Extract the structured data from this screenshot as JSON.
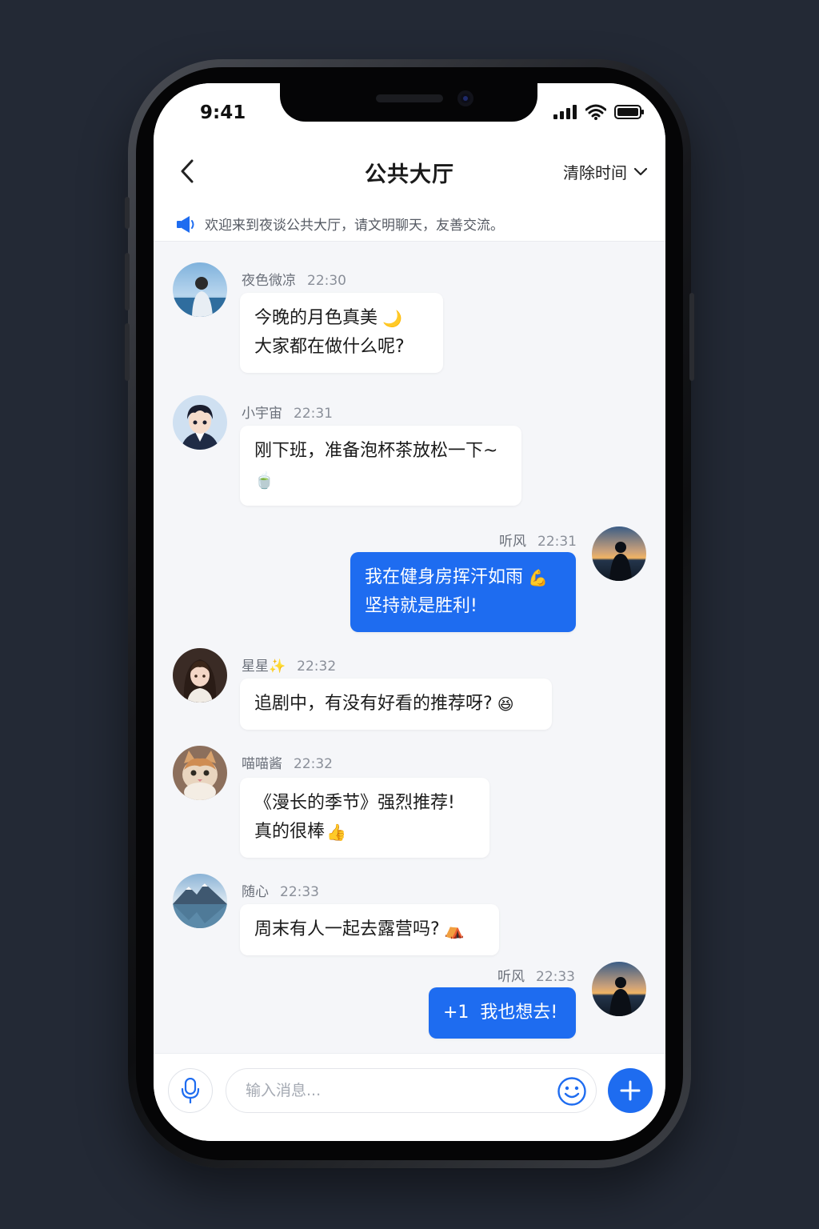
{
  "status_bar": {
    "time": "9:41"
  },
  "header": {
    "title": "公共大厅",
    "clear_label": "清除时间"
  },
  "notice": {
    "text": "欢迎来到夜谈公共大厅，请文明聊天，友善交流。"
  },
  "messages": [
    {
      "user": "夜色微凉",
      "time": "22:30",
      "lines": [
        "今晚的月色真美",
        "大家都在做什么呢?"
      ],
      "emoji": "🌙",
      "self": false,
      "avatar": "man-by-sea"
    },
    {
      "user": "小宇宙",
      "time": "22:31",
      "lines": [
        "刚下班，准备泡杯茶放松一下~",
        ""
      ],
      "emoji": "🍵",
      "self": false,
      "avatar": "anime-boy"
    },
    {
      "user": "听风",
      "time": "22:31",
      "lines": [
        "我在健身房挥汗如雨",
        "坚持就是胜利!"
      ],
      "emoji": "💪",
      "self": true,
      "avatar": "sunset-silhouette"
    },
    {
      "user": "星星✨",
      "time": "22:32",
      "lines": [
        "追剧中，有没有好看的推荐呀?"
      ],
      "emoji": "😆",
      "self": false,
      "avatar": "girl-portrait"
    },
    {
      "user": "喵喵酱",
      "time": "22:32",
      "lines": [
        "《漫长的季节》强烈推荐!",
        "真的很棒"
      ],
      "emoji": "👍",
      "self": false,
      "avatar": "cat"
    },
    {
      "user": "随心",
      "time": "22:33",
      "lines": [
        "周末有人一起去露营吗?"
      ],
      "emoji": "⛺",
      "self": false,
      "avatar": "mountain-lake"
    },
    {
      "user": "听风",
      "time": "22:33",
      "lines": [
        "+1  我也想去!"
      ],
      "emoji": "",
      "self": true,
      "avatar": "sunset-silhouette"
    }
  ],
  "composer": {
    "placeholder": "输入消息..."
  },
  "colors": {
    "accent": "#1e6cf0",
    "background": "#f5f6f9",
    "bubble_other": "#ffffff"
  },
  "icons": [
    "back-icon",
    "chevron-down-icon",
    "megaphone-icon",
    "mic-icon",
    "smile-icon",
    "plus-icon",
    "signal-icon",
    "wifi-icon",
    "battery-icon"
  ]
}
